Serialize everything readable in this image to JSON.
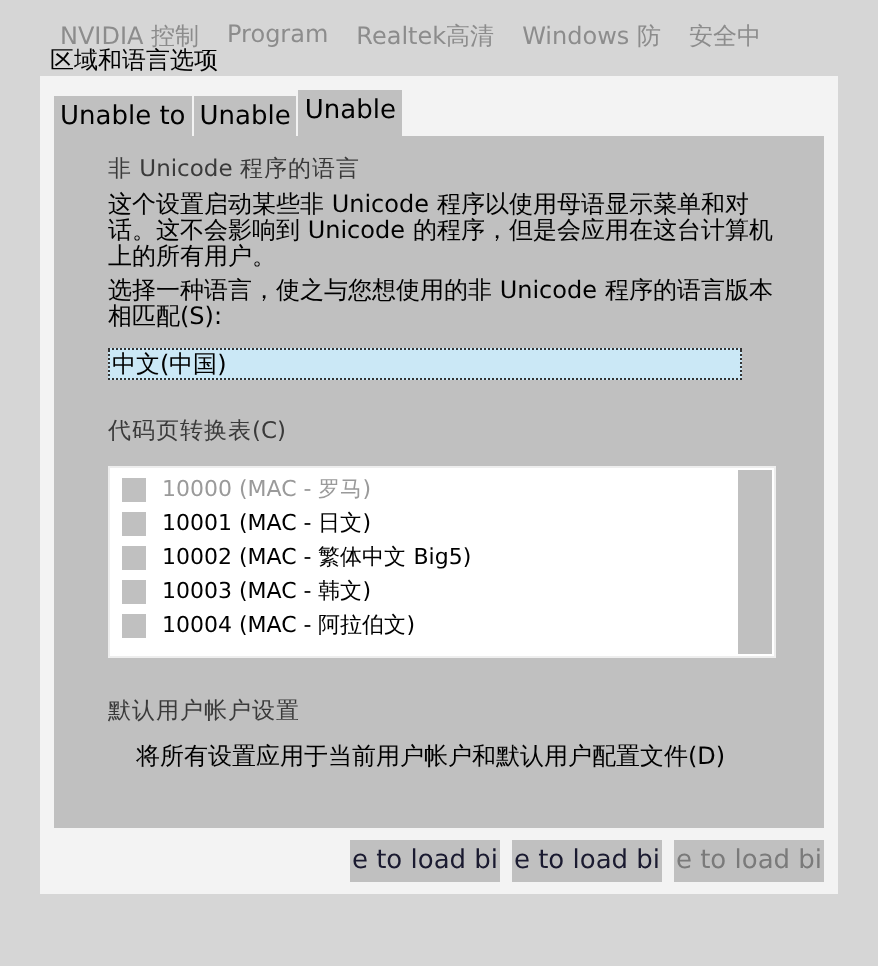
{
  "desktop_icons": [
    {
      "label": "NVIDIA 控制"
    },
    {
      "label": "Program"
    },
    {
      "label": "Realtek高清"
    },
    {
      "label": "Windows 防"
    },
    {
      "label": "安全中"
    }
  ],
  "window": {
    "title": "区域和语言选项"
  },
  "tabs": [
    {
      "label": "Unable to",
      "selected": false
    },
    {
      "label": "Unable",
      "selected": false
    },
    {
      "label": "Unable",
      "selected": true
    }
  ],
  "non_unicode": {
    "heading": "非 Unicode 程序的语言",
    "description": "这个设置启动某些非 Unicode 程序以使用母语显示菜单和对话。这不会影响到 Unicode 的程序，但是会应用在这台计算机上的所有用户。",
    "prompt": "选择一种语言，使之与您想使用的非 Unicode 程序的语言版本相匹配(S):",
    "language": "中文(中国)"
  },
  "code_pages": {
    "label": "代码页转换表(C)",
    "items": [
      {
        "label": "10000 (MAC - 罗马)",
        "checked": false,
        "disabled": true
      },
      {
        "label": "10001 (MAC - 日文)",
        "checked": false,
        "disabled": false
      },
      {
        "label": "10002 (MAC - 繁体中文 Big5)",
        "checked": false,
        "disabled": false
      },
      {
        "label": "10003 (MAC - 韩文)",
        "checked": false,
        "disabled": false
      },
      {
        "label": "10004 (MAC - 阿拉伯文)",
        "checked": false,
        "disabled": false
      }
    ]
  },
  "default_settings": {
    "heading": "默认用户帐户设置",
    "checkbox_label": "将所有设置应用于当前用户帐户和默认用户配置文件(D)"
  },
  "buttons": [
    {
      "label": "e to load bi",
      "disabled": false
    },
    {
      "label": "e to load bi",
      "disabled": false
    },
    {
      "label": "e to load bi",
      "disabled": true
    }
  ]
}
